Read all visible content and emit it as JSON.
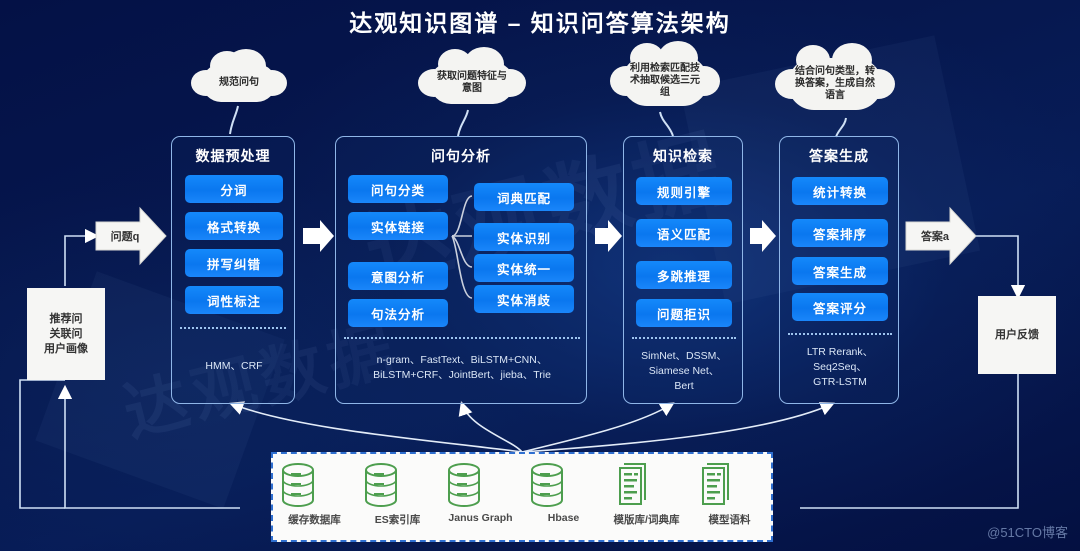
{
  "page": {
    "title": "达观知识图谱 – 知识问答算法架构",
    "watermark": "@51CTO博客",
    "bg_watermark": "达观数据"
  },
  "callouts": [
    {
      "text": "规范问句"
    },
    {
      "text": "获取问题特征与意图"
    },
    {
      "text": "利用检索匹配技术抽取候选三元组"
    },
    {
      "text": "结合问句类型，转换答案，生成自然语言"
    }
  ],
  "flow": {
    "input_arrow_label": "问题q",
    "output_arrow_label": "答案a",
    "left_box": "推荐问\n关联问\n用户画像",
    "left_box_lines": [
      "推荐问",
      "关联问",
      "用户画像"
    ],
    "right_box": "用户反馈"
  },
  "panels": [
    {
      "title": "数据预处理",
      "items": [
        "分词",
        "格式转换",
        "拼写纠错",
        "词性标注"
      ],
      "footer": "HMM、CRF"
    },
    {
      "title": "问句分析",
      "items": [
        "问句分类",
        "实体链接",
        "意图分析",
        "句法分析"
      ],
      "sub_items": [
        "词典匹配",
        "实体识别",
        "实体统一",
        "实体消歧"
      ],
      "footer_line1": "n-gram、FastText、BiLSTM+CNN、",
      "footer_line2": "BiLSTM+CRF、JointBert、jieba、Trie"
    },
    {
      "title": "知识检索",
      "items": [
        "规则引擎",
        "语义匹配",
        "多跳推理",
        "问题拒识"
      ],
      "footer_line1": "SimNet、DSSM、",
      "footer_line2": "Siamese Net、",
      "footer_line3": "Bert"
    },
    {
      "title": "答案生成",
      "items": [
        "统计转换",
        "答案排序",
        "答案生成",
        "答案评分"
      ],
      "footer_line1": "LTR Rerank、",
      "footer_line2": "Seq2Seq、",
      "footer_line3": "GTR-LSTM"
    }
  ],
  "storage": {
    "items": [
      {
        "label": "缓存数据库",
        "icon": "database-icon"
      },
      {
        "label": "ES索引库",
        "icon": "database-icon"
      },
      {
        "label": "Janus Graph",
        "icon": "database-icon"
      },
      {
        "label": "Hbase",
        "icon": "database-icon"
      },
      {
        "label": "模版库/词典库",
        "icon": "document-icon"
      },
      {
        "label": "模型语料",
        "icon": "document-icon"
      }
    ]
  },
  "colors": {
    "background_navy": "#041146",
    "chip_blue": "#0b7ff0",
    "panel_border": "#8fb6e8",
    "storage_green": "#4d9e4e",
    "storage_border": "#2f6fd0"
  }
}
